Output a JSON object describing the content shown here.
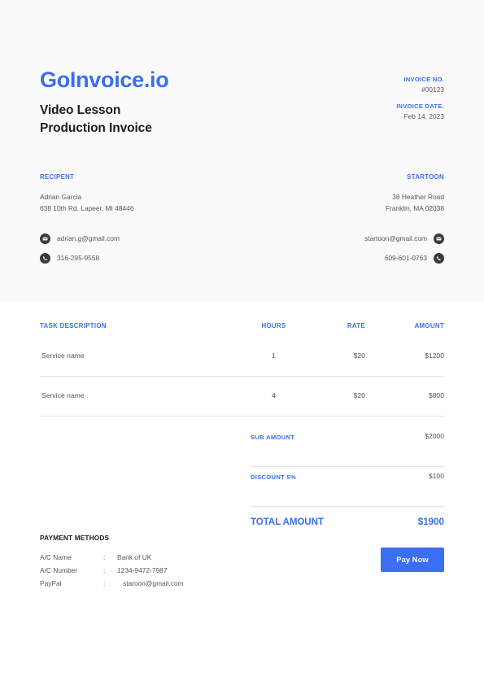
{
  "theme": {
    "accent": "#3b6ef0",
    "text": "#55555f",
    "heading": "#1b1b1f",
    "band_bg": "#fafafa",
    "page_bg": "#ffffff",
    "rule": "#e3e3e6",
    "icon_bg": "#3a3a42"
  },
  "header": {
    "brand": "GoInvoice.io",
    "title_line1": "Video Lesson",
    "title_line2": "Production Invoice",
    "meta": {
      "invoice_no_label": "INVOICE NO.",
      "invoice_no_value": "#00123",
      "invoice_date_label": "INVOICE DATE.",
      "invoice_date_value": "Feb 14, 2023"
    }
  },
  "recipient": {
    "title": "RECIPENT",
    "name": "Adrian Garcia",
    "address": "638 10th Rd.  Lapeer, MI 48446",
    "email": "adrian.g@gmail.com",
    "phone": "316-295-9558",
    "email_icon": "envelope-icon",
    "phone_icon": "phone-icon"
  },
  "sender": {
    "title": "STARTOON",
    "address_line1": "38 Heather Road",
    "address_line2": "Franklin, MA 02038",
    "email": "startoon@gmail.com",
    "phone": "609-601-0763",
    "email_icon": "envelope-icon",
    "phone_icon": "phone-icon"
  },
  "table": {
    "columns": {
      "description": "TASK DESCRIPTION",
      "hours": "HOURS",
      "rate": "RATE",
      "amount": "AMOUNT"
    },
    "rows": [
      {
        "description": "Service name",
        "hours": "1",
        "rate": "$20",
        "amount": "$1200"
      },
      {
        "description": "Service name",
        "hours": "4",
        "rate": "$20",
        "amount": "$800"
      }
    ]
  },
  "totals": {
    "sub_label": "SUB AMOUNT",
    "sub_value": "$2000",
    "discount_label": "DISCOUNT 5%",
    "discount_value": "$100",
    "total_label": "TOTAL AMOUNT",
    "total_value": "$1900"
  },
  "payment": {
    "title": "PAYMENT METHODS",
    "colon": ":",
    "rows": [
      {
        "key": "A/C Name",
        "value": "Bank of UK"
      },
      {
        "key": "A/C Number",
        "value": "1234-9472-7987"
      },
      {
        "key": "PayPal",
        "value": "staroon@gmail.com"
      }
    ],
    "pay_button": "Pay Now"
  }
}
